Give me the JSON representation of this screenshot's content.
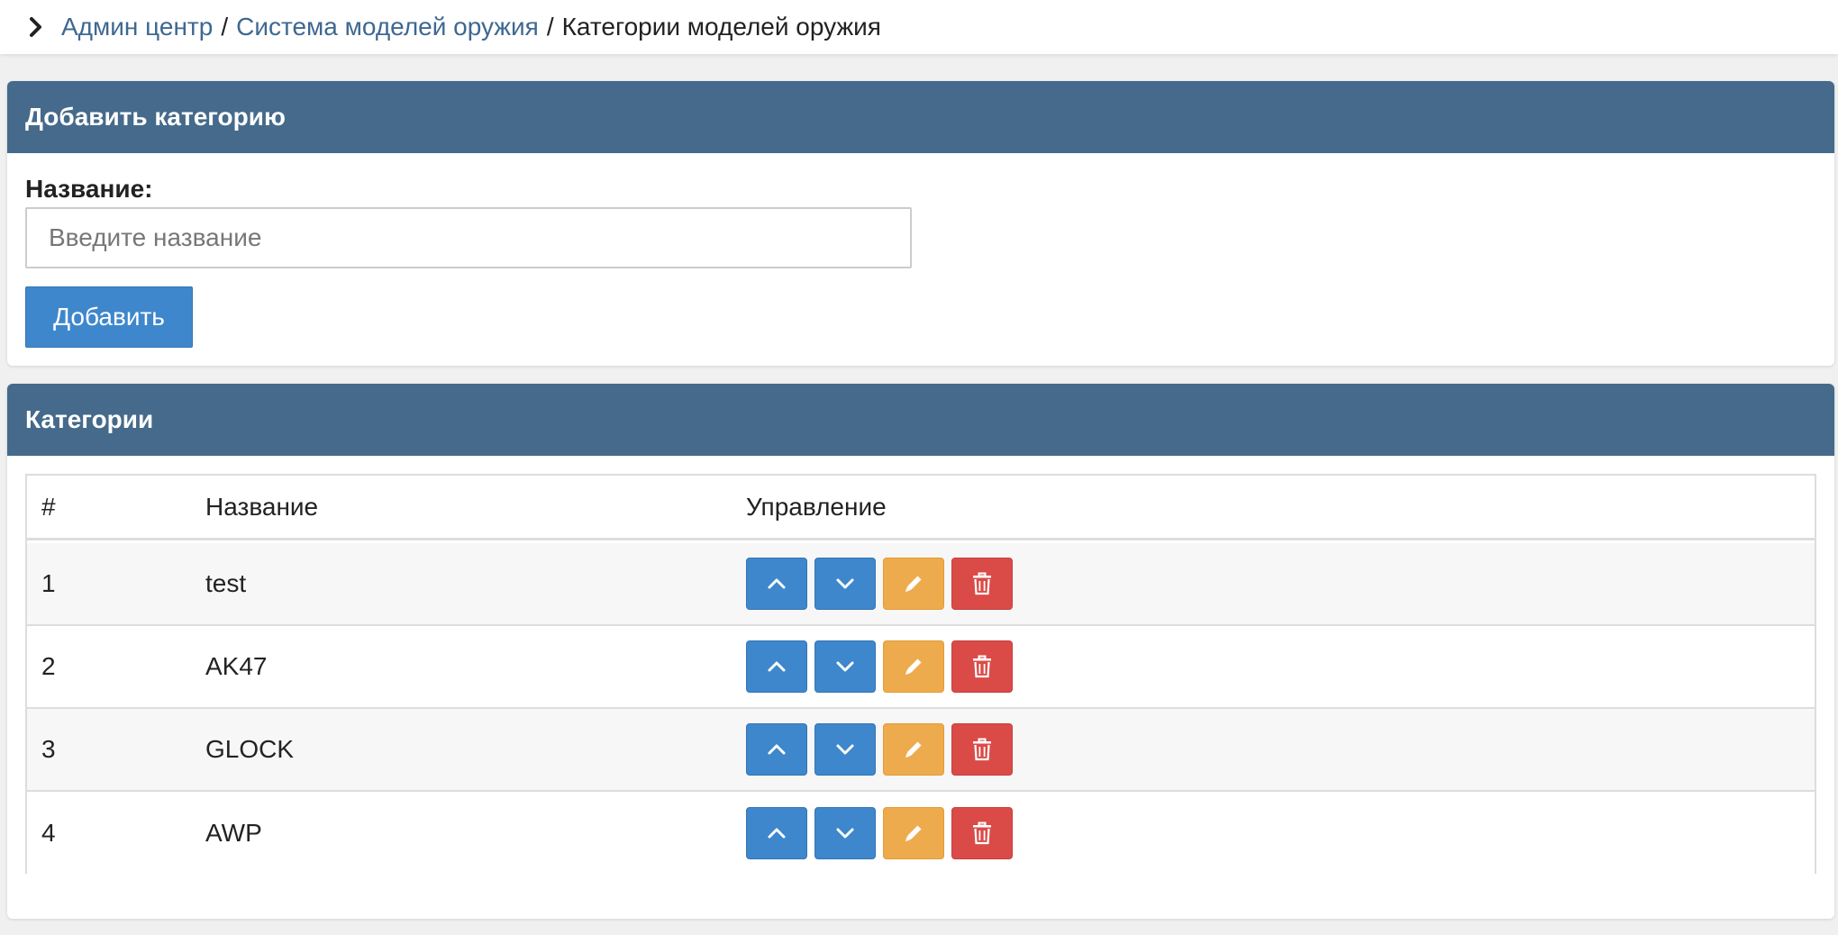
{
  "breadcrumb": {
    "items": [
      "Админ центр",
      "Система моделей оружия"
    ],
    "separator": "/",
    "current": "Категории моделей оружия"
  },
  "add_panel": {
    "title": "Добавить категорию",
    "label": "Название:",
    "placeholder": "Введите название",
    "button": "Добавить"
  },
  "list_panel": {
    "title": "Категории",
    "columns": [
      "#",
      "Название",
      "Управление"
    ],
    "rows": [
      {
        "num": "1",
        "name": "test"
      },
      {
        "num": "2",
        "name": "AK47"
      },
      {
        "num": "3",
        "name": "GLOCK"
      },
      {
        "num": "4",
        "name": "AWP"
      }
    ]
  },
  "icons": {
    "breadcrumb": "chevron-right-icon",
    "up": "chevron-up-icon",
    "down": "chevron-down-icon",
    "edit": "pencil-icon",
    "delete": "trash-icon"
  },
  "colors": {
    "header": "#456a8b",
    "primary": "#3e87cc",
    "warning": "#eeab4d",
    "danger": "#da4b48",
    "link": "#3e6891"
  }
}
